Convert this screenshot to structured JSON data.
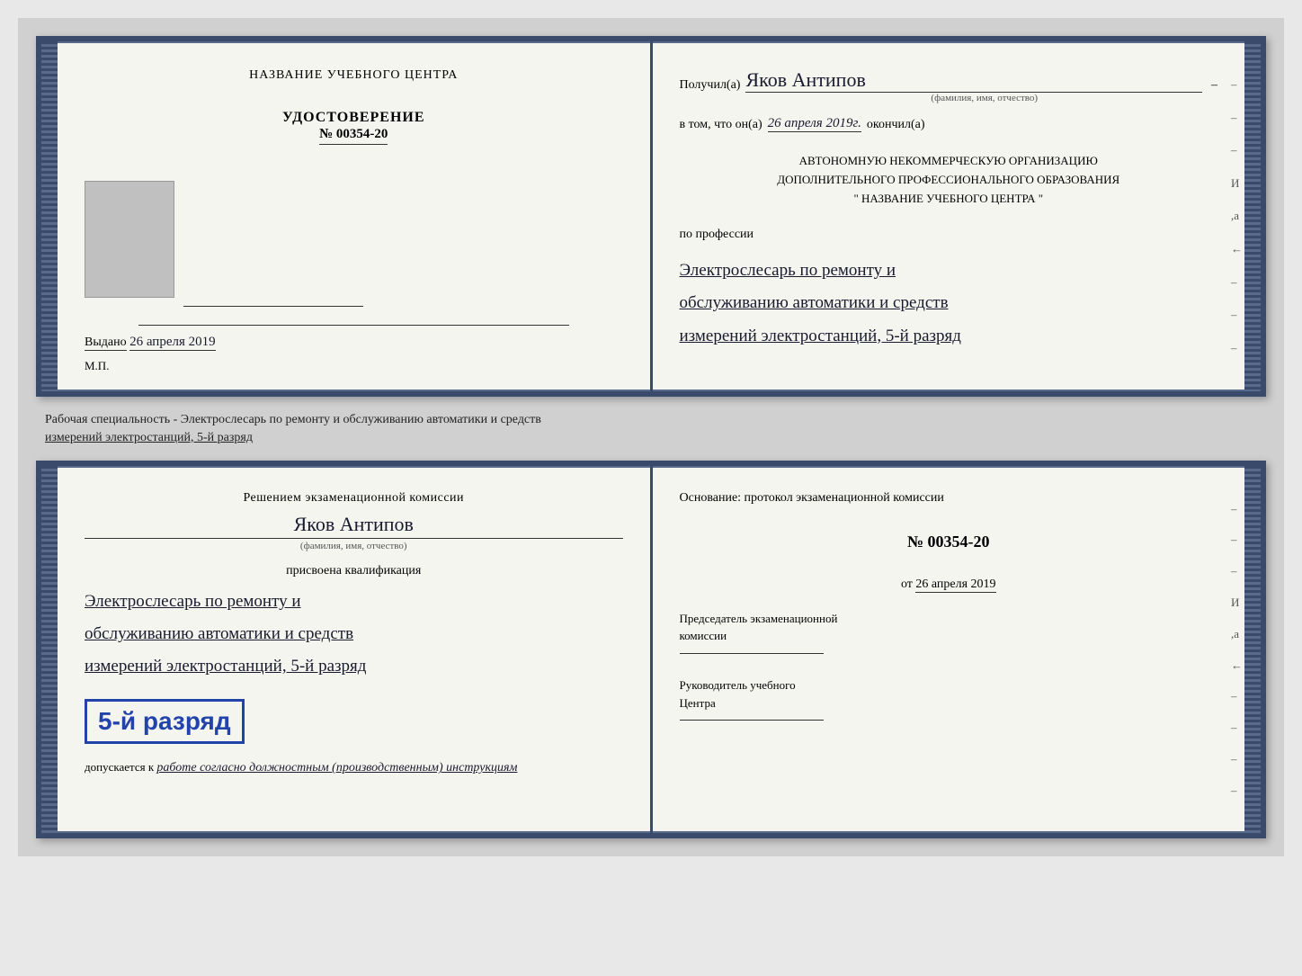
{
  "top": {
    "left": {
      "center_title": "НАЗВАНИЕ УЧЕБНОГО ЦЕНТРА",
      "udostoverenie": "УДОСТОВЕРЕНИЕ",
      "number": "№ 00354-20",
      "vydano_label": "Выдано",
      "vydano_date": "26 апреля 2019",
      "mp": "М.П."
    },
    "right": {
      "poluchil_label": "Получил(а)",
      "fio_handwritten": "Яков Антипов",
      "fio_sublabel": "(фамилия, имя, отчество)",
      "vtom_prefix": "в том, что он(а)",
      "vtom_date": "26 апреля 2019г.",
      "okochil_label": "окончил(а)",
      "org_line1": "АВТОНОМНУЮ НЕКОММЕРЧЕСКУЮ ОРГАНИЗАЦИЮ",
      "org_line2": "ДОПОЛНИТЕЛЬНОГО ПРОФЕССИОНАЛЬНОГО ОБРАЗОВАНИЯ",
      "org_name": "\" НАЗВАНИЕ УЧЕБНОГО ЦЕНТРА \"",
      "po_professii": "по профессии",
      "profession_line1": "Электрослесарь по ремонту и",
      "profession_line2": "обслуживанию автоматики и средств",
      "profession_line3": "измерений электростанций, 5-й разряд"
    }
  },
  "middle": {
    "text1": "Рабочая специальность - Электрослесарь по ремонту и обслуживанию автоматики и средств",
    "text2": "измерений электростанций, 5-й разряд"
  },
  "bottom": {
    "left": {
      "resheniem": "Решением экзаменационной комиссии",
      "fio_handwritten": "Яков Антипов",
      "fio_sublabel": "(фамилия, имя, отчество)",
      "prisvoena": "присвоена квалификация",
      "prof_line1": "Электрослесарь по ремонту и",
      "prof_line2": "обслуживанию автоматики и средств",
      "prof_line3": "измерений электростанций, 5-й разряд",
      "razryad_badge": "5-й разряд",
      "dopuskaetsya_prefix": "допускается к",
      "dopuskaetsya_italic": "работе согласно должностным (производственным) инструкциям"
    },
    "right": {
      "osnovanie": "Основание: протокол экзаменационной комиссии",
      "proto_num": "№ 00354-20",
      "ot_label": "от",
      "ot_date": "26 апреля 2019",
      "predsedatel_line1": "Председатель экзаменационной",
      "predsedatel_line2": "комиссии",
      "rukovoditel_line1": "Руководитель учебного",
      "rukovoditel_line2": "Центра"
    },
    "right_marks": [
      "–",
      "–",
      "–",
      "И",
      ",а",
      "←",
      "–",
      "–",
      "–",
      "–"
    ]
  },
  "top_right_marks": [
    "–",
    "–",
    "–",
    "И",
    ",а",
    "←",
    "–",
    "–",
    "–"
  ]
}
